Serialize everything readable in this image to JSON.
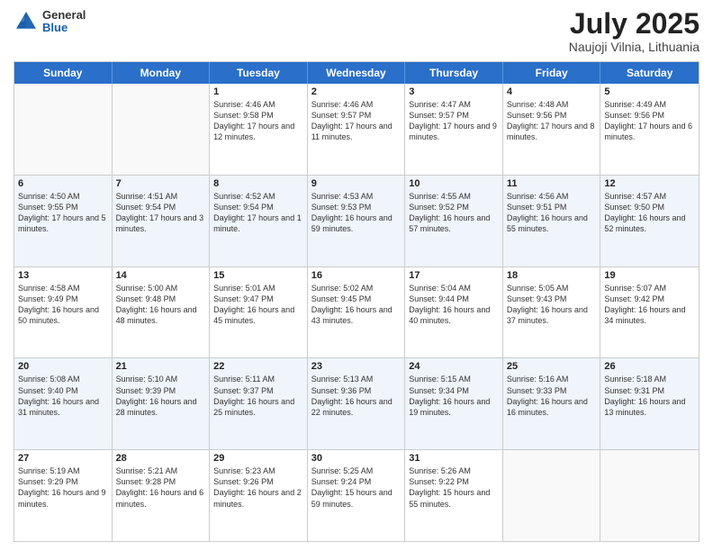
{
  "logo": {
    "general": "General",
    "blue": "Blue"
  },
  "title": {
    "month": "July 2025",
    "location": "Naujoji Vilnia, Lithuania"
  },
  "header_days": [
    "Sunday",
    "Monday",
    "Tuesday",
    "Wednesday",
    "Thursday",
    "Friday",
    "Saturday"
  ],
  "rows": [
    {
      "alt": false,
      "cells": [
        {
          "day": "",
          "empty": true,
          "sunrise": "",
          "sunset": "",
          "daylight": ""
        },
        {
          "day": "",
          "empty": true,
          "sunrise": "",
          "sunset": "",
          "daylight": ""
        },
        {
          "day": "1",
          "empty": false,
          "sunrise": "Sunrise: 4:46 AM",
          "sunset": "Sunset: 9:58 PM",
          "daylight": "Daylight: 17 hours and 12 minutes."
        },
        {
          "day": "2",
          "empty": false,
          "sunrise": "Sunrise: 4:46 AM",
          "sunset": "Sunset: 9:57 PM",
          "daylight": "Daylight: 17 hours and 11 minutes."
        },
        {
          "day": "3",
          "empty": false,
          "sunrise": "Sunrise: 4:47 AM",
          "sunset": "Sunset: 9:57 PM",
          "daylight": "Daylight: 17 hours and 9 minutes."
        },
        {
          "day": "4",
          "empty": false,
          "sunrise": "Sunrise: 4:48 AM",
          "sunset": "Sunset: 9:56 PM",
          "daylight": "Daylight: 17 hours and 8 minutes."
        },
        {
          "day": "5",
          "empty": false,
          "sunrise": "Sunrise: 4:49 AM",
          "sunset": "Sunset: 9:56 PM",
          "daylight": "Daylight: 17 hours and 6 minutes."
        }
      ]
    },
    {
      "alt": true,
      "cells": [
        {
          "day": "6",
          "empty": false,
          "sunrise": "Sunrise: 4:50 AM",
          "sunset": "Sunset: 9:55 PM",
          "daylight": "Daylight: 17 hours and 5 minutes."
        },
        {
          "day": "7",
          "empty": false,
          "sunrise": "Sunrise: 4:51 AM",
          "sunset": "Sunset: 9:54 PM",
          "daylight": "Daylight: 17 hours and 3 minutes."
        },
        {
          "day": "8",
          "empty": false,
          "sunrise": "Sunrise: 4:52 AM",
          "sunset": "Sunset: 9:54 PM",
          "daylight": "Daylight: 17 hours and 1 minute."
        },
        {
          "day": "9",
          "empty": false,
          "sunrise": "Sunrise: 4:53 AM",
          "sunset": "Sunset: 9:53 PM",
          "daylight": "Daylight: 16 hours and 59 minutes."
        },
        {
          "day": "10",
          "empty": false,
          "sunrise": "Sunrise: 4:55 AM",
          "sunset": "Sunset: 9:52 PM",
          "daylight": "Daylight: 16 hours and 57 minutes."
        },
        {
          "day": "11",
          "empty": false,
          "sunrise": "Sunrise: 4:56 AM",
          "sunset": "Sunset: 9:51 PM",
          "daylight": "Daylight: 16 hours and 55 minutes."
        },
        {
          "day": "12",
          "empty": false,
          "sunrise": "Sunrise: 4:57 AM",
          "sunset": "Sunset: 9:50 PM",
          "daylight": "Daylight: 16 hours and 52 minutes."
        }
      ]
    },
    {
      "alt": false,
      "cells": [
        {
          "day": "13",
          "empty": false,
          "sunrise": "Sunrise: 4:58 AM",
          "sunset": "Sunset: 9:49 PM",
          "daylight": "Daylight: 16 hours and 50 minutes."
        },
        {
          "day": "14",
          "empty": false,
          "sunrise": "Sunrise: 5:00 AM",
          "sunset": "Sunset: 9:48 PM",
          "daylight": "Daylight: 16 hours and 48 minutes."
        },
        {
          "day": "15",
          "empty": false,
          "sunrise": "Sunrise: 5:01 AM",
          "sunset": "Sunset: 9:47 PM",
          "daylight": "Daylight: 16 hours and 45 minutes."
        },
        {
          "day": "16",
          "empty": false,
          "sunrise": "Sunrise: 5:02 AM",
          "sunset": "Sunset: 9:45 PM",
          "daylight": "Daylight: 16 hours and 43 minutes."
        },
        {
          "day": "17",
          "empty": false,
          "sunrise": "Sunrise: 5:04 AM",
          "sunset": "Sunset: 9:44 PM",
          "daylight": "Daylight: 16 hours and 40 minutes."
        },
        {
          "day": "18",
          "empty": false,
          "sunrise": "Sunrise: 5:05 AM",
          "sunset": "Sunset: 9:43 PM",
          "daylight": "Daylight: 16 hours and 37 minutes."
        },
        {
          "day": "19",
          "empty": false,
          "sunrise": "Sunrise: 5:07 AM",
          "sunset": "Sunset: 9:42 PM",
          "daylight": "Daylight: 16 hours and 34 minutes."
        }
      ]
    },
    {
      "alt": true,
      "cells": [
        {
          "day": "20",
          "empty": false,
          "sunrise": "Sunrise: 5:08 AM",
          "sunset": "Sunset: 9:40 PM",
          "daylight": "Daylight: 16 hours and 31 minutes."
        },
        {
          "day": "21",
          "empty": false,
          "sunrise": "Sunrise: 5:10 AM",
          "sunset": "Sunset: 9:39 PM",
          "daylight": "Daylight: 16 hours and 28 minutes."
        },
        {
          "day": "22",
          "empty": false,
          "sunrise": "Sunrise: 5:11 AM",
          "sunset": "Sunset: 9:37 PM",
          "daylight": "Daylight: 16 hours and 25 minutes."
        },
        {
          "day": "23",
          "empty": false,
          "sunrise": "Sunrise: 5:13 AM",
          "sunset": "Sunset: 9:36 PM",
          "daylight": "Daylight: 16 hours and 22 minutes."
        },
        {
          "day": "24",
          "empty": false,
          "sunrise": "Sunrise: 5:15 AM",
          "sunset": "Sunset: 9:34 PM",
          "daylight": "Daylight: 16 hours and 19 minutes."
        },
        {
          "day": "25",
          "empty": false,
          "sunrise": "Sunrise: 5:16 AM",
          "sunset": "Sunset: 9:33 PM",
          "daylight": "Daylight: 16 hours and 16 minutes."
        },
        {
          "day": "26",
          "empty": false,
          "sunrise": "Sunrise: 5:18 AM",
          "sunset": "Sunset: 9:31 PM",
          "daylight": "Daylight: 16 hours and 13 minutes."
        }
      ]
    },
    {
      "alt": false,
      "cells": [
        {
          "day": "27",
          "empty": false,
          "sunrise": "Sunrise: 5:19 AM",
          "sunset": "Sunset: 9:29 PM",
          "daylight": "Daylight: 16 hours and 9 minutes."
        },
        {
          "day": "28",
          "empty": false,
          "sunrise": "Sunrise: 5:21 AM",
          "sunset": "Sunset: 9:28 PM",
          "daylight": "Daylight: 16 hours and 6 minutes."
        },
        {
          "day": "29",
          "empty": false,
          "sunrise": "Sunrise: 5:23 AM",
          "sunset": "Sunset: 9:26 PM",
          "daylight": "Daylight: 16 hours and 2 minutes."
        },
        {
          "day": "30",
          "empty": false,
          "sunrise": "Sunrise: 5:25 AM",
          "sunset": "Sunset: 9:24 PM",
          "daylight": "Daylight: 15 hours and 59 minutes."
        },
        {
          "day": "31",
          "empty": false,
          "sunrise": "Sunrise: 5:26 AM",
          "sunset": "Sunset: 9:22 PM",
          "daylight": "Daylight: 15 hours and 55 minutes."
        },
        {
          "day": "",
          "empty": true,
          "sunrise": "",
          "sunset": "",
          "daylight": ""
        },
        {
          "day": "",
          "empty": true,
          "sunrise": "",
          "sunset": "",
          "daylight": ""
        }
      ]
    }
  ]
}
